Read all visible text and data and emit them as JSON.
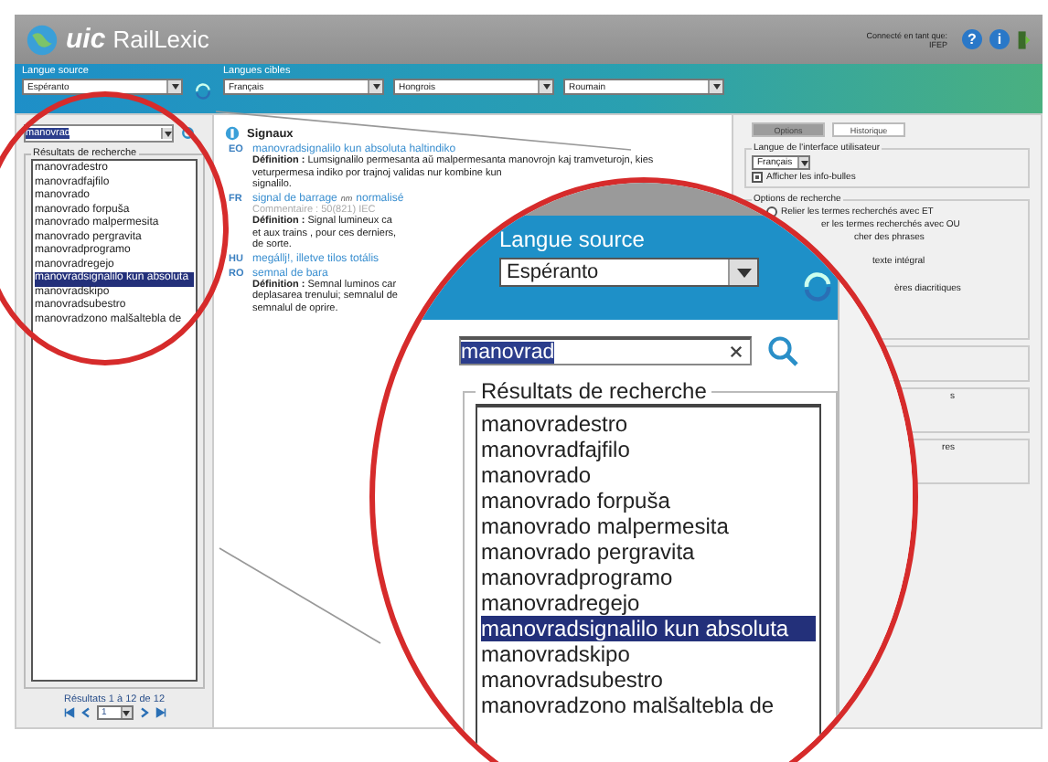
{
  "header": {
    "logo_text": "uic",
    "app_name": "RailLexic",
    "user_label": "Connecté en tant que:",
    "user_name": "IFEP",
    "help_glyph": "?",
    "info_glyph": "i"
  },
  "language_bar": {
    "source_label": "Langue source",
    "source_value": "Espéranto",
    "targets_label": "Langues cibles",
    "target_values": [
      "Français",
      "Hongrois",
      "Roumain"
    ]
  },
  "search": {
    "value": "manovrad",
    "results_title": "Résultats de recherche",
    "results": [
      {
        "text": "manovradestro",
        "selected": false
      },
      {
        "text": "manovradfajfilo",
        "selected": false
      },
      {
        "text": "manovrado",
        "selected": false
      },
      {
        "text": "manovrado forpuša",
        "selected": false
      },
      {
        "text": "manovrado malpermesita",
        "selected": false
      },
      {
        "text": "manovrado pergravita",
        "selected": false
      },
      {
        "text": "manovradprogramo",
        "selected": false
      },
      {
        "text": "manovradregejo",
        "selected": false
      },
      {
        "text": "manovradsignalilo kun absoluta",
        "selected": true
      },
      {
        "text": "manovradskipo",
        "selected": false
      },
      {
        "text": "manovradsubestro",
        "selected": false
      },
      {
        "text": "manovradzono malšaltebla de",
        "selected": false
      }
    ],
    "pagination": {
      "summary": "Résultats 1 à 12 de 12",
      "page": "1"
    }
  },
  "entry": {
    "title": "Signaux",
    "translations": [
      {
        "lang": "EO",
        "term": "manovradsignalilo kun absoluta haltindiko",
        "lines": [
          "**Définition :** Lumsignalilo permesanta aŭ malpermesanta manovrojn kaj tramveturojn, kies",
          "veturpermesa indiko por trajnoj validas nur kombine kun",
          "signalilo."
        ]
      },
      {
        "lang": "FR",
        "term": "signal de barrage",
        "grammar": "nm",
        "status": "normalisé",
        "comment": "Commentaire : 50(821) IEC",
        "lines": [
          "**Définition :** Signal lumineux ca",
          "et aux trains , pour ces derniers,",
          "de sorte."
        ]
      },
      {
        "lang": "HU",
        "term": "megállj!, illetve tilos totális"
      },
      {
        "lang": "RO",
        "term": "semnal de bara",
        "lines": [
          "**Définition :** Semnal luminos car",
          "deplasarea trenului; semnalul de",
          "semnalul de oprire."
        ]
      }
    ]
  },
  "options_panel": {
    "tabs": [
      {
        "label": "Options",
        "selected": true
      },
      {
        "label": "Historique",
        "selected": false
      }
    ],
    "ui_language": {
      "title": "Langue de l'interface utilisateur",
      "value": "Français",
      "tooltips": {
        "label": "Afficher les info-bulles",
        "checked": true
      }
    },
    "search_options": {
      "title": "Options de recherche",
      "item": {
        "label": "Relier les termes recherchés avec ET",
        "checked": false
      },
      "partial_items": [
        "er les termes recherchés avec OU",
        "cher des phrases",
        "texte intégral",
        "ères diacritiques"
      ]
    },
    "lower_fragments": [
      "s",
      "res"
    ]
  },
  "magnifier": {
    "source_label": "Langue source",
    "source_value": "Espéranto",
    "search_value": "manovrad",
    "results_title": "Résultats de recherche",
    "results": [
      {
        "text": "manovradestro",
        "selected": false
      },
      {
        "text": "manovradfajfilo",
        "selected": false
      },
      {
        "text": "manovrado",
        "selected": false
      },
      {
        "text": "manovrado forpuša",
        "selected": false
      },
      {
        "text": "manovrado malpermesita",
        "selected": false
      },
      {
        "text": "manovrado pergravita",
        "selected": false
      },
      {
        "text": "manovradprogramo",
        "selected": false
      },
      {
        "text": "manovradregejo",
        "selected": false
      },
      {
        "text": "manovradsignalilo kun absoluta",
        "selected": true
      },
      {
        "text": "manovradskipo",
        "selected": false
      },
      {
        "text": "manovradsubestro",
        "selected": false
      },
      {
        "text": "manovradzono malšaltebla de",
        "selected": false
      }
    ]
  }
}
